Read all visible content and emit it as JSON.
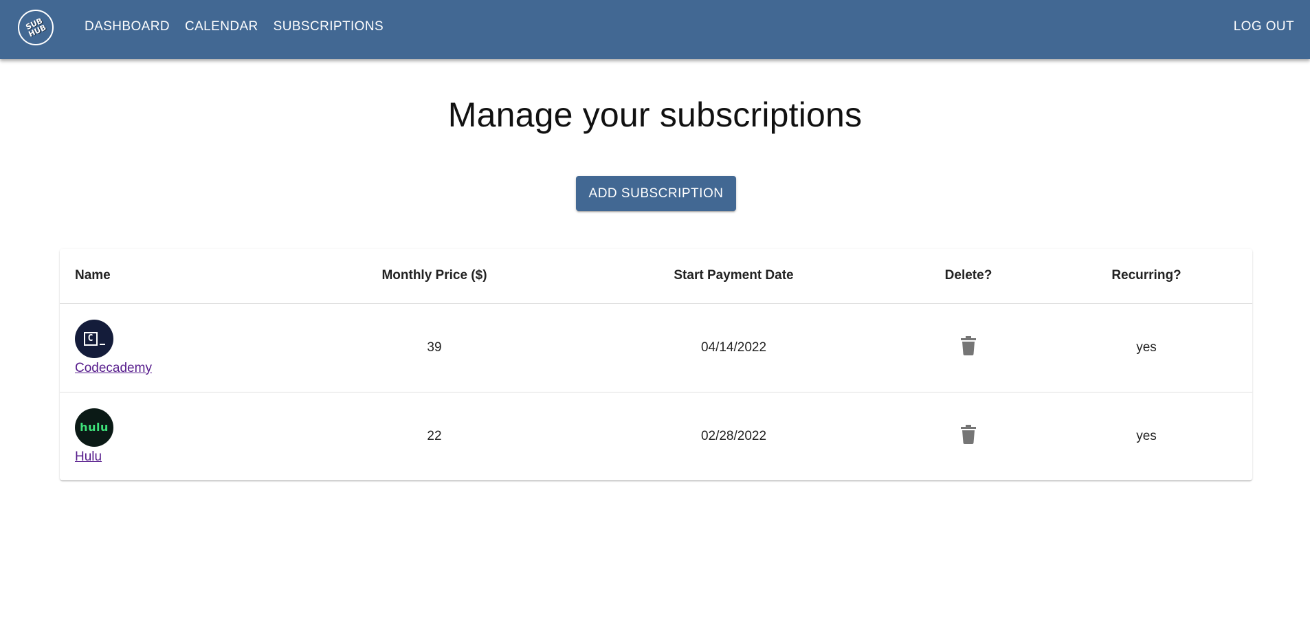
{
  "brand": {
    "logo_text": "SUB HUB"
  },
  "nav": {
    "items": [
      {
        "label": "DASHBOARD"
      },
      {
        "label": "CALENDAR"
      },
      {
        "label": "SUBSCRIPTIONS"
      }
    ],
    "logout_label": "LOG OUT"
  },
  "page": {
    "title": "Manage your subscriptions",
    "add_button_label": "ADD SUBSCRIPTION"
  },
  "table": {
    "headers": {
      "name": "Name",
      "price": "Monthly Price ($)",
      "date": "Start Payment Date",
      "delete": "Delete?",
      "recurring": "Recurring?"
    },
    "rows": [
      {
        "name": "Codecademy",
        "icon": "codecademy-logo",
        "logo_text": "C",
        "price": "39",
        "date": "04/14/2022",
        "recurring": "yes"
      },
      {
        "name": "Hulu",
        "icon": "hulu-logo",
        "logo_text": "hulu",
        "price": "22",
        "date": "02/28/2022",
        "recurring": "yes"
      }
    ]
  },
  "colors": {
    "primary": "#426893",
    "link_visited": "#551a8b",
    "icon_gray": "#757575"
  }
}
